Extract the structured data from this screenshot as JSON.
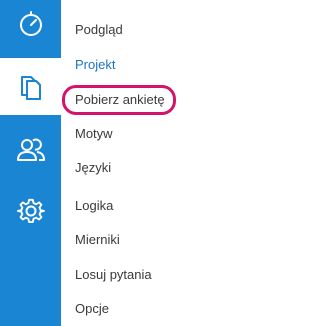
{
  "sidebar": {
    "items": [
      {
        "icon": "timer-icon",
        "active": false
      },
      {
        "icon": "documents-icon",
        "active": true
      },
      {
        "icon": "users-icon",
        "active": false
      },
      {
        "icon": "gear-icon",
        "active": false
      }
    ],
    "background": "#1a86d3",
    "icon_color": "#ffffff",
    "active_icon_color": "#1a86d3"
  },
  "menu": {
    "items": [
      {
        "label": "Podgląd"
      },
      {
        "label": "Projekt",
        "active": true
      },
      {
        "label": "Pobierz ankietę",
        "highlighted": true
      },
      {
        "label": "Motyw"
      },
      {
        "label": "Języki"
      },
      {
        "label": "Logika"
      },
      {
        "label": "Mierniki"
      },
      {
        "label": "Losuj pytania"
      },
      {
        "label": "Opcje"
      }
    ],
    "active_color": "#1a75c7",
    "text_color": "#3a3a3a"
  },
  "highlight": {
    "color": "#d4146c"
  }
}
